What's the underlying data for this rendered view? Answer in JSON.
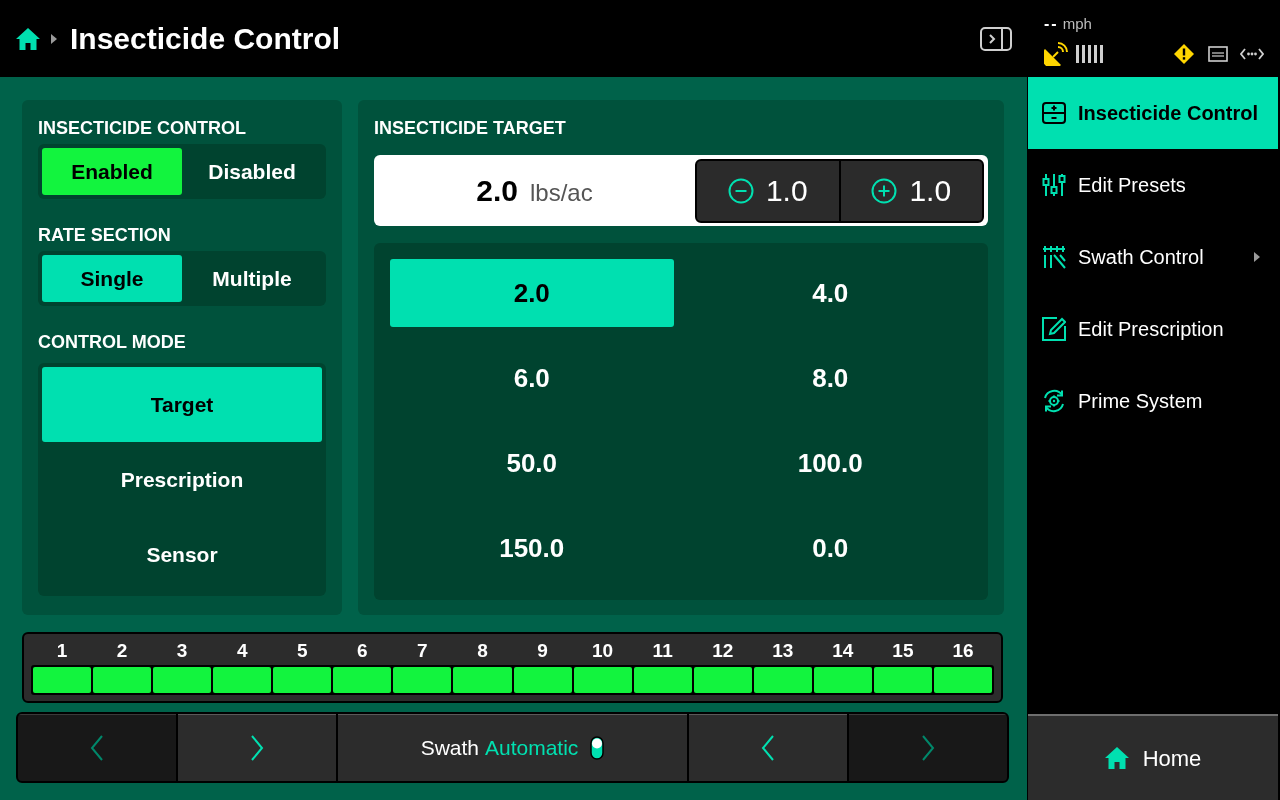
{
  "header": {
    "title": "Insecticide Control"
  },
  "status": {
    "speed_value": "--",
    "speed_unit": "mph"
  },
  "control_panel": {
    "groups": [
      {
        "label": "INSECTICIDE CONTROL",
        "kind": "switch",
        "options": [
          {
            "label": "Enabled",
            "selected": true
          },
          {
            "label": "Disabled",
            "selected": false
          }
        ]
      },
      {
        "label": "RATE SECTION",
        "kind": "segmented",
        "options": [
          {
            "label": "Single",
            "selected": true
          },
          {
            "label": "Multiple",
            "selected": false
          }
        ]
      },
      {
        "label": "CONTROL MODE",
        "kind": "list",
        "options": [
          {
            "label": "Target",
            "selected": true
          },
          {
            "label": "Prescription",
            "selected": false
          },
          {
            "label": "Sensor",
            "selected": false
          }
        ]
      }
    ]
  },
  "target_panel": {
    "label": "INSECTICIDE TARGET",
    "value": "2.0",
    "unit": "lbs/ac",
    "steppers": [
      {
        "kind": "decrease",
        "amount": "1.0"
      },
      {
        "kind": "increase",
        "amount": "1.0"
      }
    ],
    "presets": [
      {
        "label": "2.0",
        "selected": true
      },
      {
        "label": "4.0",
        "selected": false
      },
      {
        "label": "6.0",
        "selected": false
      },
      {
        "label": "8.0",
        "selected": false
      },
      {
        "label": "50.0",
        "selected": false
      },
      {
        "label": "100.0",
        "selected": false
      },
      {
        "label": "150.0",
        "selected": false
      },
      {
        "label": "0.0",
        "selected": false
      }
    ]
  },
  "sections": [
    {
      "number": "1",
      "on": true
    },
    {
      "number": "2",
      "on": true
    },
    {
      "number": "3",
      "on": true
    },
    {
      "number": "4",
      "on": true
    },
    {
      "number": "5",
      "on": true
    },
    {
      "number": "6",
      "on": true
    },
    {
      "number": "7",
      "on": true
    },
    {
      "number": "8",
      "on": true
    },
    {
      "number": "9",
      "on": true
    },
    {
      "number": "10",
      "on": true
    },
    {
      "number": "11",
      "on": true
    },
    {
      "number": "12",
      "on": true
    },
    {
      "number": "13",
      "on": true
    },
    {
      "number": "14",
      "on": true
    },
    {
      "number": "15",
      "on": true
    },
    {
      "number": "16",
      "on": true
    }
  ],
  "bottom_bar": [
    {
      "kind": "previous",
      "disabled": true
    },
    {
      "kind": "next",
      "disabled": false
    },
    {
      "kind": "swath",
      "label": "Swath",
      "mode": "Automatic"
    },
    {
      "kind": "previous",
      "disabled": false
    },
    {
      "kind": "next",
      "disabled": true
    }
  ],
  "sidebar": {
    "items": [
      {
        "label": "Insecticide Control",
        "kind": "insecticide",
        "selected": true,
        "submenu": false
      },
      {
        "label": "Edit Presets",
        "kind": "presets",
        "selected": false,
        "submenu": false
      },
      {
        "label": "Swath Control",
        "kind": "swath",
        "selected": false,
        "submenu": true
      },
      {
        "label": "Edit Prescription",
        "kind": "prescription",
        "selected": false,
        "submenu": false
      },
      {
        "label": "Prime System",
        "kind": "prime",
        "selected": false,
        "submenu": false
      }
    ]
  },
  "home_button": {
    "label": "Home"
  }
}
